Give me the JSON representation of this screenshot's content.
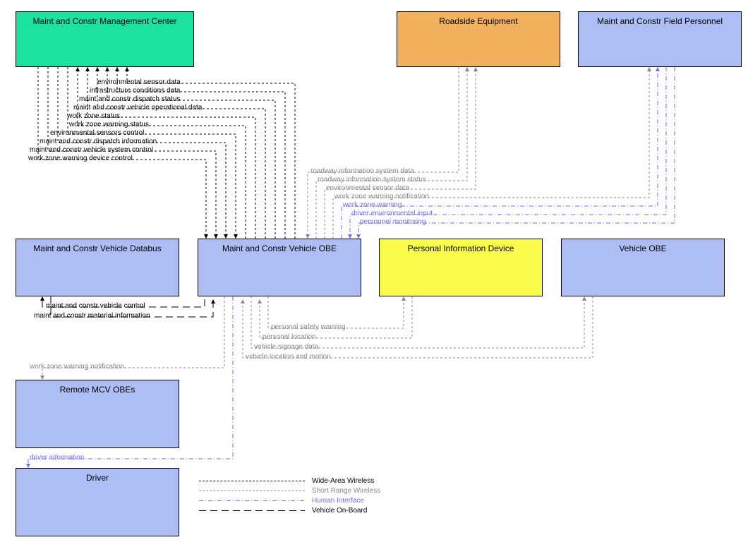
{
  "boxes": {
    "mgmt_center": "Maint and Constr Management Center",
    "roadside": "Roadside Equipment",
    "field_personnel": "Maint and Constr Field Personnel",
    "databus": "Maint and Constr Vehicle Databus",
    "mcv_obe": "Maint and Constr Vehicle OBE",
    "pid": "Personal Information Device",
    "vehicle_obe": "Vehicle OBE",
    "remote_mcv": "Remote MCV OBEs",
    "driver": "Driver"
  },
  "flows": {
    "env_sensor_data": "environmental sensor data",
    "infra_cond": "infrastructure conditions data",
    "dispatch_status": "maint and constr dispatch status",
    "veh_op_data": "maint and constr vehicle operational data",
    "wz_status": "work zone status",
    "wz_warn_status": "work zone warning status",
    "env_sensor_ctrl": "environmental sensors control",
    "dispatch_info": "maint and constr dispatch information",
    "veh_sys_ctrl": "maint and constr vehicle system control",
    "wz_warn_dev_ctrl": "work zone warning device control",
    "ris_data": "roadway information system data",
    "ris_status": "roadway information system status",
    "env_sensor_data2": "environmental sensor data",
    "wz_warn_notif": "work zone warning notification",
    "wz_warning": "work zone warning",
    "driver_env_input": "driver environmental input",
    "personnel_mon": "personnel monitoring",
    "veh_ctrl": "maint and constr vehicle control",
    "material_info": "maint and constr material information",
    "safety_warn": "personal safety warning",
    "pers_loc": "personal location",
    "veh_signage": "vehicle signage data",
    "veh_loc_motion": "vehicle location and motion",
    "wz_warn_notif2": "work zone warning notification",
    "driver_info": "driver information"
  },
  "legend": {
    "wide": "Wide-Area Wireless",
    "short": "Short Range Wireless",
    "human": "Human Interface",
    "onboard": "Vehicle On-Board"
  },
  "colors": {
    "green": "#1be29e",
    "orange": "#f2b25d",
    "blue": "#adbef5",
    "yellow": "#fbfb4b",
    "human": "#6e6ef2",
    "gray": "#898989"
  }
}
